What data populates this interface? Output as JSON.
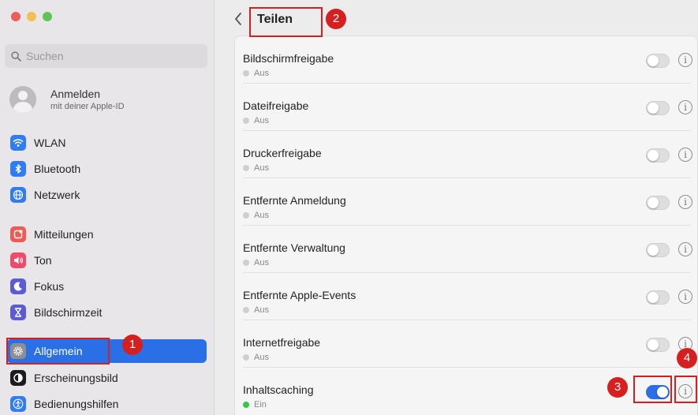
{
  "sidebar": {
    "search_placeholder": "Suchen",
    "apple_id": {
      "title": "Anmelden",
      "subtitle": "mit deiner Apple-ID"
    },
    "items": [
      {
        "label": "WLAN",
        "icon": "wifi-icon",
        "color": "#2f7cf6"
      },
      {
        "label": "Bluetooth",
        "icon": "bluetooth-icon",
        "color": "#2f7cf6"
      },
      {
        "label": "Netzwerk",
        "icon": "globe-icon",
        "color": "#2f7cf6"
      },
      {
        "label": "Mitteilungen",
        "icon": "bell-icon",
        "color": "#f05a55"
      },
      {
        "label": "Ton",
        "icon": "speaker-icon",
        "color": "#f04a6b"
      },
      {
        "label": "Fokus",
        "icon": "moon-icon",
        "color": "#5b5bd6"
      },
      {
        "label": "Bildschirmzeit",
        "icon": "hourglass-icon",
        "color": "#5b5bd6"
      },
      {
        "label": "Allgemein",
        "icon": "gear-icon",
        "color": "#8e8e93",
        "active": true
      },
      {
        "label": "Erscheinungsbild",
        "icon": "appearance-icon",
        "color": "#1c1c1e"
      },
      {
        "label": "Bedienungshilfen",
        "icon": "accessibility-icon",
        "color": "#2f7cf6"
      }
    ]
  },
  "main": {
    "title": "Teilen",
    "rows": [
      {
        "name": "Bildschirmfreigabe",
        "status": "Aus",
        "on": false
      },
      {
        "name": "Dateifreigabe",
        "status": "Aus",
        "on": false
      },
      {
        "name": "Druckerfreigabe",
        "status": "Aus",
        "on": false
      },
      {
        "name": "Entfernte Anmeldung",
        "status": "Aus",
        "on": false
      },
      {
        "name": "Entfernte Verwaltung",
        "status": "Aus",
        "on": false
      },
      {
        "name": "Entfernte Apple-Events",
        "status": "Aus",
        "on": false
      },
      {
        "name": "Internetfreigabe",
        "status": "Aus",
        "on": false
      },
      {
        "name": "Inhaltscaching",
        "status": "Ein",
        "on": true
      }
    ]
  },
  "annotations": {
    "badge_1": "1",
    "badge_2": "2",
    "badge_3": "3",
    "badge_4": "4"
  },
  "colors": {
    "accent": "#2a6fe6",
    "annotation": "#d6201f",
    "status_on": "#36c74a"
  }
}
